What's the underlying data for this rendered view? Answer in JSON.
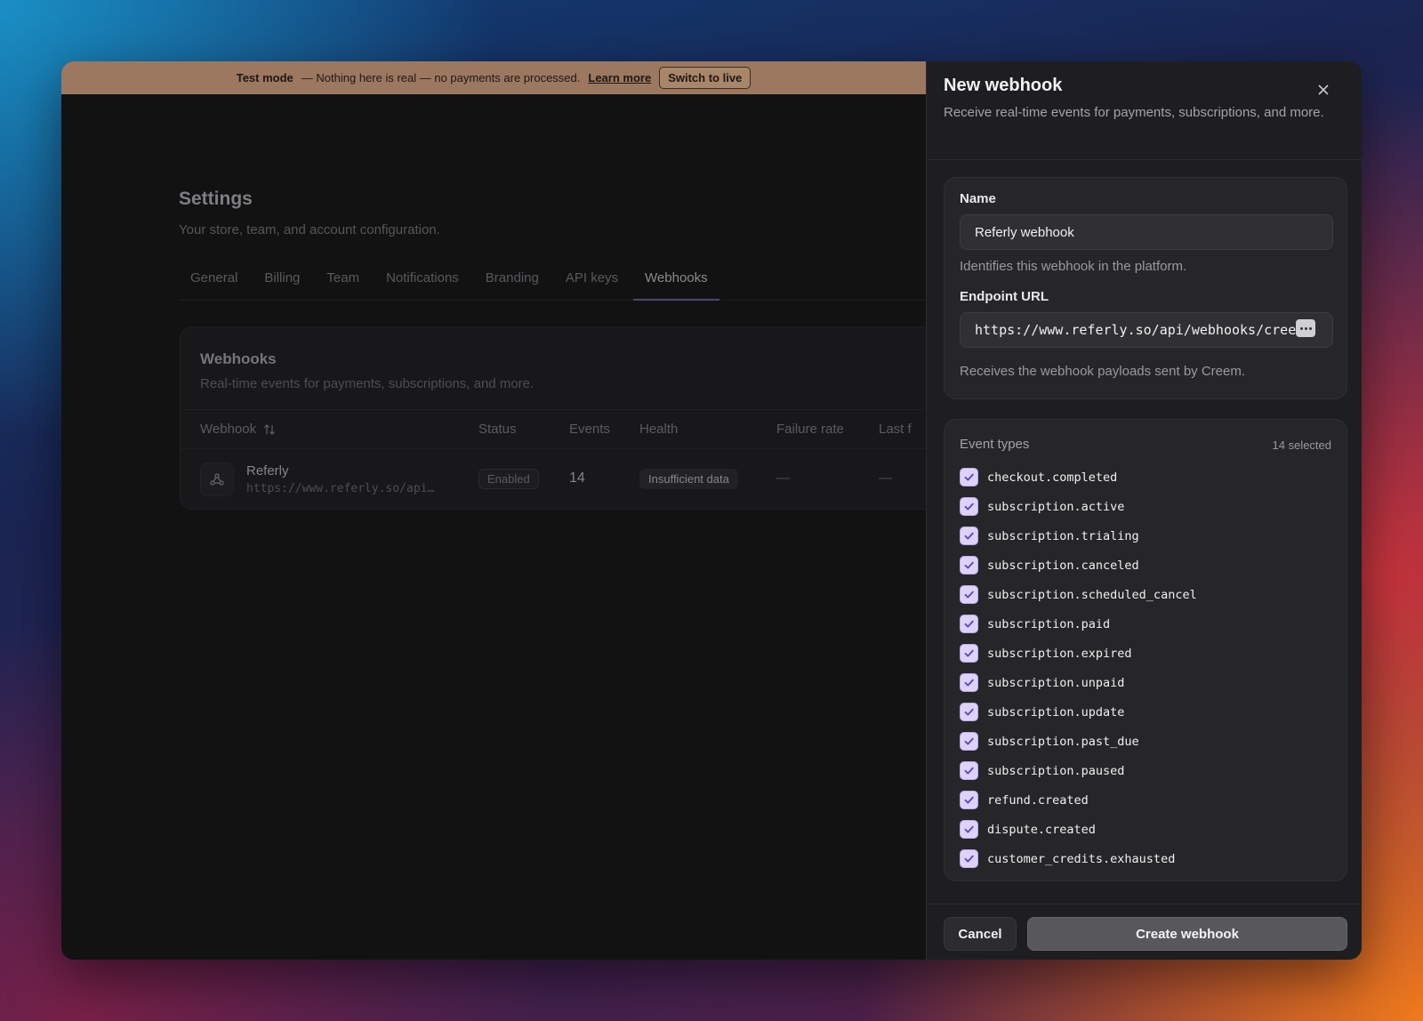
{
  "banner": {
    "title": "Test mode",
    "message": "— Nothing here is real — no payments are processed.",
    "learn_more": "Learn more",
    "switch_label": "Switch to live"
  },
  "settings": {
    "title": "Settings",
    "subtitle": "Your store, team, and account configuration.",
    "tabs": [
      {
        "label": "General"
      },
      {
        "label": "Billing"
      },
      {
        "label": "Team"
      },
      {
        "label": "Notifications"
      },
      {
        "label": "Branding"
      },
      {
        "label": "API keys"
      },
      {
        "label": "Webhooks",
        "active": true
      }
    ]
  },
  "webhooks_card": {
    "title": "Webhooks",
    "subtitle": "Real-time events for payments, subscriptions, and more.",
    "columns": {
      "webhook": "Webhook",
      "sort_icon": "sort-arrows-icon",
      "status": "Status",
      "events": "Events",
      "health": "Health",
      "failure_rate": "Failure rate",
      "last": "Last f"
    },
    "rows": [
      {
        "icon": "webhook-icon",
        "name": "Referly",
        "url": "https://www.referly.so/api…",
        "status": "Enabled",
        "events": "14",
        "health": "Insufficient data",
        "failure_rate": "—",
        "last": "—"
      }
    ]
  },
  "panel": {
    "title": "New webhook",
    "description": "Receive real-time events for payments, subscriptions, and more.",
    "close_icon": "close-icon",
    "name_label": "Name",
    "name_value": "Referly webhook",
    "name_help": "Identifies this webhook in the platform.",
    "url_label": "Endpoint URL",
    "url_value": "https://www.referly.so/api/webhooks/creem",
    "url_help": "Receives the webhook payloads sent by Creem.",
    "events_label": "Event types",
    "events_count": "14 selected",
    "events": [
      {
        "name": "checkout.completed",
        "checked": true
      },
      {
        "name": "subscription.active",
        "checked": true
      },
      {
        "name": "subscription.trialing",
        "checked": true
      },
      {
        "name": "subscription.canceled",
        "checked": true
      },
      {
        "name": "subscription.scheduled_cancel",
        "checked": true
      },
      {
        "name": "subscription.paid",
        "checked": true
      },
      {
        "name": "subscription.expired",
        "checked": true
      },
      {
        "name": "subscription.unpaid",
        "checked": true
      },
      {
        "name": "subscription.update",
        "checked": true
      },
      {
        "name": "subscription.past_due",
        "checked": true
      },
      {
        "name": "subscription.paused",
        "checked": true
      },
      {
        "name": "refund.created",
        "checked": true
      },
      {
        "name": "dispute.created",
        "checked": true
      },
      {
        "name": "customer_credits.exhausted",
        "checked": true
      }
    ],
    "cancel_label": "Cancel",
    "create_label": "Create webhook"
  },
  "colors": {
    "banner": "#9c7860",
    "checkbox": "#ddd3fa",
    "check": "#5b3fc4"
  }
}
